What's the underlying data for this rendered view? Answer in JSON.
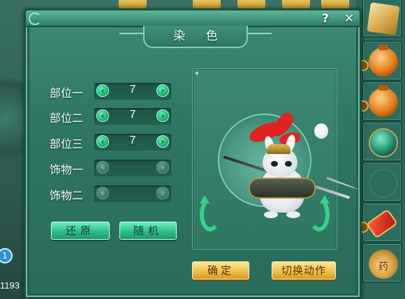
{
  "dialog": {
    "title": "染 色",
    "help_label": "?",
    "close_label": "✕"
  },
  "parts": [
    {
      "label": "部位一",
      "value": "7",
      "enabled": true
    },
    {
      "label": "部位二",
      "value": "7",
      "enabled": true
    },
    {
      "label": "部位三",
      "value": "7",
      "enabled": true
    },
    {
      "label": "饰物一",
      "value": "",
      "enabled": false
    },
    {
      "label": "饰物二",
      "value": "",
      "enabled": false
    }
  ],
  "buttons": {
    "restore": "还原",
    "random": "随机",
    "confirm": "确定",
    "switch_action": "切换动作"
  },
  "background": {
    "badge_number": "1",
    "edge_number": "1193"
  },
  "inventory": {
    "bag_char": "药"
  },
  "icons": {
    "arrow_left": "chevron-left-icon",
    "arrow_right": "chevron-right-icon",
    "rotate_left": "rotate-left-icon",
    "rotate_right": "rotate-right-icon",
    "help": "help-icon",
    "close": "close-icon"
  },
  "colors": {
    "panel": "#2f7664",
    "arrow_active": "#19b574",
    "button_green": "#2ebd8a",
    "button_gold": "#f2c148"
  }
}
